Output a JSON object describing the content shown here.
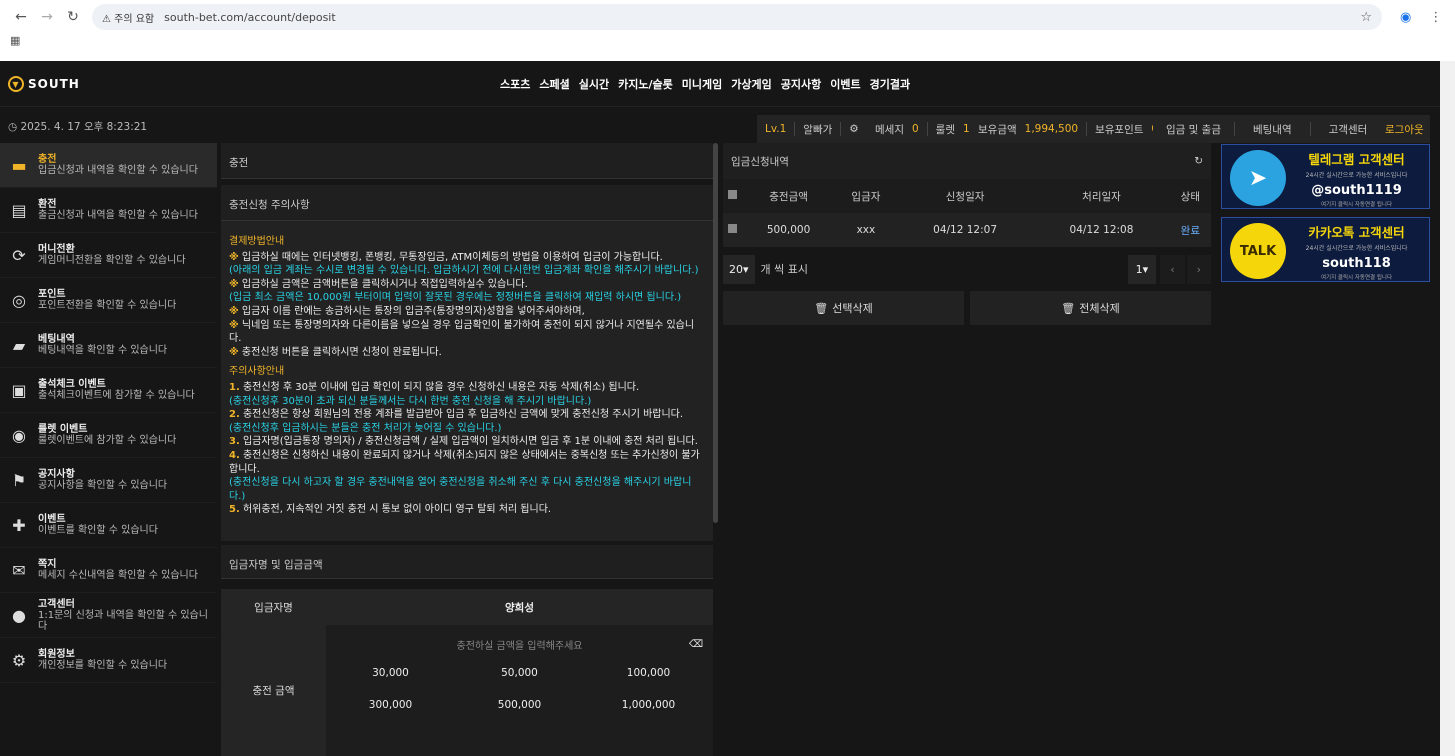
{
  "browser": {
    "warning": "주의 요함",
    "url": "south-bet.com/account/deposit"
  },
  "brand": {
    "logo_text": "SOUTH",
    "accent": "#f0b429",
    "cyan": "#29d3e6"
  },
  "menu": [
    "스포츠",
    "스페셜",
    "실시간",
    "카지노/슬롯",
    "미니게임",
    "가상게임",
    "공지사항",
    "이벤트",
    "경기결과"
  ],
  "info": {
    "datetime": "2025. 4. 17 오후 8:23:21",
    "level": "Lv.1",
    "nickname": "알빠가",
    "message_label": "메세지",
    "message_count": "0",
    "roulette_label": "룰렛",
    "roulette_count": "1",
    "balance_label": "보유금액",
    "balance": "1,994,500",
    "points_label": "보유포인트",
    "points": "0",
    "deposit_withdraw": "입금 및 출금",
    "bet_history": "베팅내역",
    "support": "고객센터",
    "logout": "로그아웃"
  },
  "sidebar": [
    {
      "title": "충전",
      "desc": "입금신청과 내역을 확인할 수 있습니다",
      "icon": "wallet-icon"
    },
    {
      "title": "환전",
      "desc": "출금신청과 내역을 확인할 수 있습니다",
      "icon": "money-icon"
    },
    {
      "title": "머니전환",
      "desc": "게임머니전환을 확인할 수 있습니다",
      "icon": "refresh-icon"
    },
    {
      "title": "포인트",
      "desc": "포인트전환을 확인할 수 있습니다",
      "icon": "coins-icon"
    },
    {
      "title": "베팅내역",
      "desc": "베팅내역을 확인할 수 있습니다",
      "icon": "folder-icon"
    },
    {
      "title": "출석체크 이벤트",
      "desc": "출석체크이벤트에 참가할 수 있습니다",
      "icon": "badge-icon"
    },
    {
      "title": "룰렛 이벤트",
      "desc": "룰렛이벤트에 참가할 수 있습니다",
      "icon": "roulette-icon"
    },
    {
      "title": "공지사항",
      "desc": "공지사항을 확인할 수 있습니다",
      "icon": "signpost-icon"
    },
    {
      "title": "이벤트",
      "desc": "이벤트를 확인할 수 있습니다",
      "icon": "gift-icon"
    },
    {
      "title": "쪽지",
      "desc": "메세지 수신내역을 확인할 수 있습니다",
      "icon": "envelope-icon"
    },
    {
      "title": "고객센터",
      "desc": "1:1문의 신청과 내역을 확인할 수 있습니다",
      "icon": "chat-icon"
    },
    {
      "title": "회원정보",
      "desc": "개인정보를 확인할 수 있습니다",
      "icon": "user-gear-icon"
    }
  ],
  "deposit": {
    "panel_title": "충전",
    "notice_title": "충전신청 주의사항",
    "method_heading": "결제방법안내",
    "method_lines": [
      {
        "mark": "※",
        "text": " 입금하실 때에는 인터넷뱅킹, 폰뱅킹, 무통장입금, ATM이체등의 방법을 이용하여 입금이 가능합니다.",
        "cyan": false
      },
      {
        "mark": "",
        "text": "(아래의 입금 계좌는 수시로 변경될 수 있습니다. 입금하시기 전에 다시한번 입금계좌 확인을 해주시기 바랍니다.)",
        "cyan": true
      },
      {
        "mark": "※",
        "text": " 입금하실 금액은 금액버튼을 클릭하시거나 직접입력하실수 있습니다.",
        "cyan": false
      },
      {
        "mark": "",
        "text": "(입금 최소 금액은 10,000원 부터이며 입력이 잘못된 경우에는 정정버튼을 클릭하여 재입력 하시면 됩니다.)",
        "cyan": true
      },
      {
        "mark": "※",
        "text": " 입금자 이름 란에는 송금하시는 통장의 입금주(통장명의자)성함을 넣어주셔야하며,",
        "cyan": false
      },
      {
        "mark": "※",
        "text": " 닉네임 또는 통장명의자와 다른이름을 넣으실 경우 입금확인이 불가하여 충전이 되지 않거나 지연될수 있습니다.",
        "cyan": false
      },
      {
        "mark": "※",
        "text": " 충전신청 버튼을 클릭하시면 신청이 완료됩니다.",
        "cyan": false
      }
    ],
    "caution_heading": "주의사항안내",
    "caution_lines": [
      {
        "mark": "1.",
        "text": " 충전신청 후 30분 이내에 입금 확인이 되지 않을 경우 신청하신 내용은 자동 삭제(취소) 됩니다.",
        "cyan": false
      },
      {
        "mark": "",
        "text": "(충전신청후 30분이 초과 되신 분들께서는 다시 한번 충전 신청을 해 주시기 바랍니다.)",
        "cyan": true
      },
      {
        "mark": "2.",
        "text": " 충전신청은 항상 회원님의 전용 계좌를 발급받아 입금 후 입금하신 금액에 맞게 충전신청 주시기 바랍니다.",
        "cyan": false
      },
      {
        "mark": "",
        "text": "(충전신청후 입금하시는 분들은 충전 처리가 늦어질 수 있습니다.)",
        "cyan": true
      },
      {
        "mark": "3.",
        "text": " 입금자명(입금통장 명의자) / 충전신청금액 / 실제 입금액이 일치하시면 입금 후 1분 이내에 충전 처리 됩니다.",
        "cyan": false
      },
      {
        "mark": "4.",
        "text": " 충전신청은 신청하신 내용이 완료되지 않거나 삭제(취소)되지 않은 상태에서는 중복신청 또는 추가신청이 불가합니다.",
        "cyan": false
      },
      {
        "mark": "",
        "text": "(충전신청을 다시 하고자 할 경우 충전내역을 열어 충전신청을 취소해 주신 후 다시 충전신청을 해주시기 바랍니다.)",
        "cyan": true
      },
      {
        "mark": "5.",
        "text": " 허위충전, 지속적인 거짓 충전 시 통보 없이 아이디 영구 탈퇴 처리 됩니다.",
        "cyan": false
      }
    ],
    "form_section": "입금자명 및 입금금액",
    "depositor_label": "입금자명",
    "depositor_value": "양희성",
    "amount_label": "충전 금액",
    "amount_placeholder": "충전하실 금액을 입력해주세요",
    "amounts": [
      "30,000",
      "50,000",
      "100,000",
      "300,000",
      "500,000",
      "1,000,000"
    ]
  },
  "history": {
    "title": "입금신청내역",
    "columns": [
      "충전금액",
      "입금자",
      "신청일자",
      "처리일자",
      "상태"
    ],
    "rows": [
      {
        "amount": "500,000",
        "name": "xxx",
        "requested": "04/12 12:07",
        "processed": "04/12 12:08",
        "status": "완료"
      }
    ],
    "page_size": "20",
    "page_size_label": "개 씩 표시",
    "page": "1",
    "delete_selected": "선택삭제",
    "delete_all": "전체삭제"
  },
  "banners": [
    {
      "title": "텔레그램 고객센터",
      "sub": "24시간 실시간으로 가능한 서비스입니다",
      "handle": "@south1119",
      "foot": "여기지 클릭시 자동연결 됩니다",
      "icon": "telegram-icon",
      "logo_text": ""
    },
    {
      "title": "카카오톡 고객센터",
      "sub": "24시간 실시간으로 가능한 서비스입니다",
      "handle": "south118",
      "foot": "여기지 클릭시 자동연결 됩니다",
      "icon": "kakaotalk-icon",
      "logo_text": "TALK"
    }
  ]
}
